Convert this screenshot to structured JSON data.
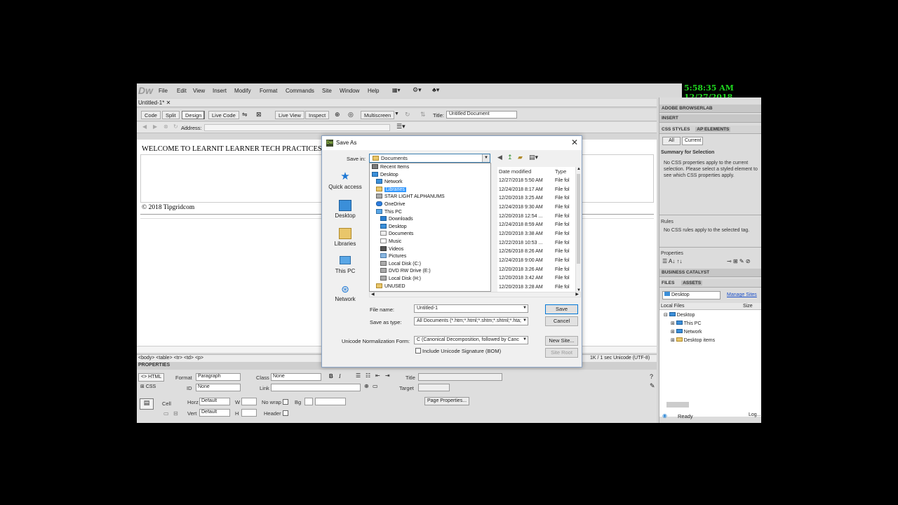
{
  "app": {
    "logo": "Dw",
    "menus": [
      "File",
      "Edit",
      "View",
      "Insert",
      "Modify",
      "Format",
      "Commands",
      "Site",
      "Window",
      "Help"
    ],
    "clock": "5:58:35 AM 12/27/2018",
    "doc_tab": "Untitled-1*",
    "toolbar": {
      "code": "Code",
      "split": "Split",
      "design": "Design",
      "live_code": "Live Code",
      "live_view": "Live View",
      "inspect": "Inspect",
      "multiscreen": "Multiscreen",
      "title_label": "Title:",
      "title_value": "Untitled Document"
    },
    "address_label": "Address:"
  },
  "design": {
    "heading": "WELCOME TO LEARNIT LEARNER TECH PRACTICES",
    "copyright": "© 2018 Tipgridcom"
  },
  "statusbar": {
    "tags": "<body> <table> <tr> <td> <p>",
    "right": "1K / 1 sec  Unicode (UTF-8)"
  },
  "properties": {
    "title": "PROPERTIES",
    "html": "HTML",
    "css": "CSS",
    "format_label": "Format",
    "format_value": "Paragraph",
    "class_label": "Class",
    "class_value": "None",
    "id_label": "ID",
    "id_value": "None",
    "link_label": "Link",
    "title_label": "Title",
    "target_label": "Target",
    "cell_label": "Cell",
    "horz_label": "Horz",
    "horz_value": "Default",
    "vert_label": "Vert",
    "vert_value": "Default",
    "w_label": "W",
    "h_label": "H",
    "nowrap_label": "No wrap",
    "bg_label": "Bg",
    "header_label": "Header",
    "page_props": "Page Properties..."
  },
  "right_panel": {
    "browserlab": "ADOBE BROWSERLAB",
    "insert": "INSERT",
    "css_styles": "CSS STYLES",
    "ap_elements": "AP ELEMENTS",
    "all": "All",
    "current": "Current",
    "summary_title": "Summary for Selection",
    "summary_text": "No CSS properties apply to the current selection.  Please select a styled element to see which CSS properties apply.",
    "rules_title": "Rules",
    "rules_text": "No CSS rules apply to the selected tag.",
    "properties_title": "Properties",
    "business_catalyst": "BUSINESS CATALYST",
    "files": "FILES",
    "assets": "ASSETS",
    "site_select": "Desktop",
    "manage_sites": "Manage Sites",
    "local_files": "Local Files",
    "size": "Size",
    "tree": [
      "Desktop",
      "This PC",
      "Network",
      "Desktop items"
    ],
    "ready": "Ready",
    "log": "Log..."
  },
  "dialog": {
    "title": "Save As",
    "save_in_label": "Save in:",
    "save_in_value": "Documents",
    "sidebar": [
      "Quick access",
      "Desktop",
      "Libraries",
      "This PC",
      "Network"
    ],
    "col_date": "Date modified",
    "col_type": "Type",
    "dropdown_items": [
      {
        "label": "Recent Items",
        "indent": 0
      },
      {
        "label": "Desktop",
        "indent": 0
      },
      {
        "label": "Network",
        "indent": 1
      },
      {
        "label": "Libraries",
        "indent": 1,
        "selected": true
      },
      {
        "label": "STAR LIGHT ALPHANUMS",
        "indent": 1
      },
      {
        "label": "OneDrive",
        "indent": 1
      },
      {
        "label": "This PC",
        "indent": 1
      },
      {
        "label": "Downloads",
        "indent": 2
      },
      {
        "label": "Desktop",
        "indent": 2
      },
      {
        "label": "Documents",
        "indent": 2
      },
      {
        "label": "Music",
        "indent": 2
      },
      {
        "label": "Videos",
        "indent": 2
      },
      {
        "label": "Pictures",
        "indent": 2
      },
      {
        "label": "Local Disk (C:)",
        "indent": 2
      },
      {
        "label": "DVD RW Drive (E:)",
        "indent": 2
      },
      {
        "label": "Local Disk (H:)",
        "indent": 2
      },
      {
        "label": "UNUSED",
        "indent": 1
      }
    ],
    "file_rows": [
      {
        "date": "12/27/2018 5:50 AM",
        "type": "File fol"
      },
      {
        "date": "12/24/2018 8:17 AM",
        "type": "File fol"
      },
      {
        "date": "12/20/2018 3:25 AM",
        "type": "File fol"
      },
      {
        "date": "12/24/2018 9:30 AM",
        "type": "File fol"
      },
      {
        "date": "12/20/2018 12:54 ...",
        "type": "File fol"
      },
      {
        "date": "12/24/2018 8:59 AM",
        "type": "File fol"
      },
      {
        "date": "12/20/2018 3:38 AM",
        "type": "File fol"
      },
      {
        "date": "12/22/2018 10:53 ...",
        "type": "File fol"
      },
      {
        "date": "12/26/2018 8:26 AM",
        "type": "File fol"
      },
      {
        "date": "12/24/2018 9:00 AM",
        "type": "File fol"
      },
      {
        "date": "12/20/2018 3:26 AM",
        "type": "File fol"
      },
      {
        "date": "12/20/2018 3:42 AM",
        "type": "File fol"
      },
      {
        "date": "12/20/2018 3:28 AM",
        "type": "File fol"
      }
    ],
    "filename_label": "File name:",
    "filename_value": "Untitled-1",
    "type_label": "Save as type:",
    "type_value": "All Documents (*.htm;*.html;*.shtm;*.shtml;*.hta;",
    "unicode_label": "Unicode Normalization Form:",
    "unicode_value": "C (Canonical Decomposition, followed by Canc",
    "bom_label": "Include Unicode Signature (BOM)",
    "save": "Save",
    "cancel": "Cancel",
    "new_site": "New Site...",
    "site_root": "Site Root"
  }
}
